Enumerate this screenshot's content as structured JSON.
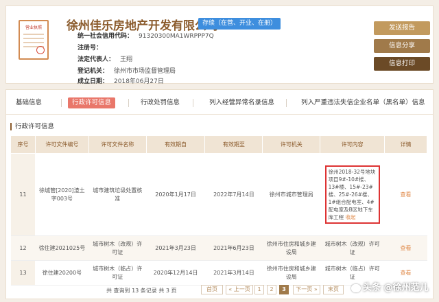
{
  "company": {
    "name": "徐州佳乐房地产开发有限公司",
    "status": "存续（在营、开业、在册）",
    "license_image_title": "营业执照",
    "fields": [
      {
        "label": "统一社会信用代码：",
        "value": "91320300MA1WRPPP7Q"
      },
      {
        "label": "注册号：",
        "value": ""
      },
      {
        "label": "法定代表人：",
        "value": "王翔"
      },
      {
        "label": "登记机关：",
        "value": "徐州市市场监督管理局"
      },
      {
        "label": "成立日期：",
        "value": "2018年06月27日"
      }
    ]
  },
  "actions": {
    "report": "发送报告",
    "share": "信息分享",
    "print": "信息打印"
  },
  "tabs": [
    {
      "label": "基础信息",
      "active": false
    },
    {
      "label": "行政许可信息",
      "active": true
    },
    {
      "label": "行政处罚信息",
      "active": false
    },
    {
      "label": "列入经营异常名录信息",
      "active": false
    },
    {
      "label": "列入严重违法失信企业名单（黑名单）信息",
      "active": false
    }
  ],
  "section_title": "行政许可信息",
  "table": {
    "headers": [
      "序号",
      "许可文件编号",
      "许可文件名称",
      "有效期自",
      "有效期至",
      "许可机关",
      "许可内容",
      "详情"
    ],
    "rows": [
      {
        "index": "11",
        "doc_no": "徐城管[2020]渣土字003号",
        "doc_name": "城市建筑垃圾处置核准",
        "valid_from": "2020年1月17日",
        "valid_to": "2022年7月14日",
        "authority": "徐州市城市管理局",
        "content": "徐州2018-32号地块项目9#-10#楼、13#楼、15#-23#楼、25#-26#楼、1#组合配电室、4#配电室及B区地下车库工程",
        "collapse": "收起",
        "detail": "查看"
      },
      {
        "index": "12",
        "doc_no": "徐住建2021025号",
        "doc_name": "城市树木（改规）许可证",
        "valid_from": "2021年3月23日",
        "valid_to": "2021年6月23日",
        "authority": "徐州市住房和城乡建设局",
        "content": "城市树木（改规）许可证",
        "collapse": "",
        "detail": "查看"
      },
      {
        "index": "13",
        "doc_no": "徐住建20200号",
        "doc_name": "城市树木（临占）许可证",
        "valid_from": "2020年12月14日",
        "valid_to": "2021年3月14日",
        "authority": "徐州市住房和城乡建设局",
        "content": "城市树木（临占）许可证",
        "collapse": "",
        "detail": "查看"
      }
    ]
  },
  "pagination": {
    "summary": "共 查询到 13 条记录 共 3 页",
    "first": "首页",
    "prev": "« 上一页",
    "pages": [
      "1",
      "2",
      "3"
    ],
    "current": "3",
    "next": "下一页 »",
    "last": "末页"
  },
  "watermark": "头条 @徐州范儿",
  "colors": {
    "brand_brown": "#8a5a2b",
    "active_tab": "#e9776a",
    "status_badge": "#3e8ede",
    "highlight_border": "#dd3333",
    "link": "#e08a4a"
  }
}
